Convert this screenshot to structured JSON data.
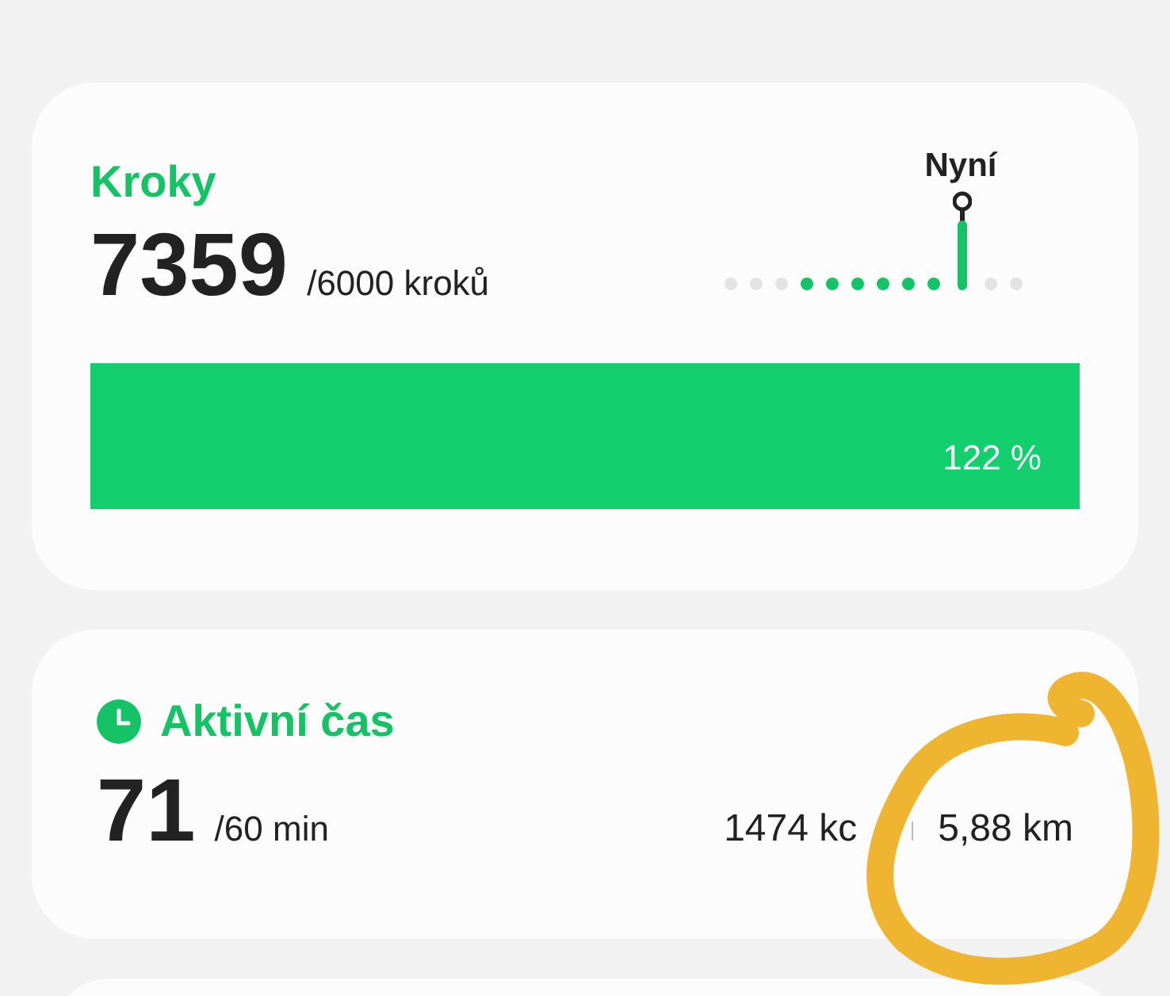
{
  "steps": {
    "title": "Kroky",
    "value": "7359",
    "goal": "/6000 kroků",
    "now_label": "Nyní",
    "timeline": [
      {
        "kind": "dot",
        "active": false
      },
      {
        "kind": "dot",
        "active": false
      },
      {
        "kind": "dot",
        "active": false
      },
      {
        "kind": "dot",
        "active": true
      },
      {
        "kind": "dot",
        "active": true
      },
      {
        "kind": "dot",
        "active": true
      },
      {
        "kind": "dot",
        "active": true
      },
      {
        "kind": "dot",
        "active": true
      },
      {
        "kind": "dot",
        "active": true
      },
      {
        "kind": "now",
        "active": true
      },
      {
        "kind": "dot",
        "active": false
      },
      {
        "kind": "dot",
        "active": false
      }
    ],
    "progress": {
      "level": 1,
      "reading": "122 %"
    }
  },
  "active_time": {
    "title": "Aktivní čas",
    "value": "71",
    "goal": "/60 min",
    "calories": "1474 kc",
    "distance": "5,88 km"
  }
}
